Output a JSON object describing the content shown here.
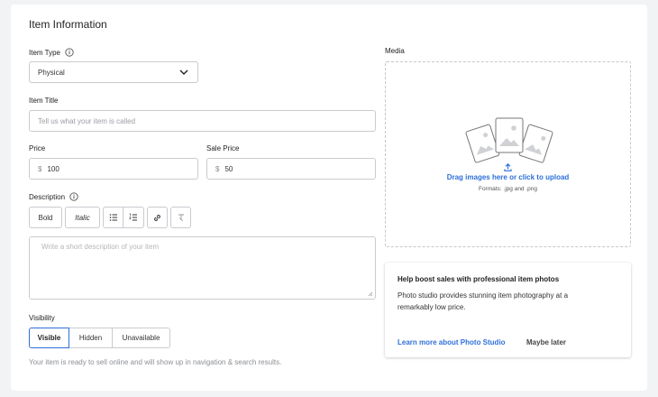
{
  "section_title": "Item Information",
  "item_type": {
    "label": "Item Type",
    "value": "Physical",
    "info_icon": "info-icon"
  },
  "item_title": {
    "label": "Item Title",
    "placeholder": "Tell us what your item is called"
  },
  "price": {
    "label": "Price",
    "prefix": "$",
    "value": "100"
  },
  "sale_price": {
    "label": "Sale Price",
    "prefix": "$",
    "value": "50"
  },
  "description": {
    "label": "Description",
    "placeholder": "Write a short description of your item",
    "toolbar": {
      "bold": "Bold",
      "italic": "Italic",
      "icons": [
        "bulleted-list-icon",
        "numbered-list-icon",
        "link-icon",
        "clear-formatting-icon"
      ]
    }
  },
  "visibility": {
    "label": "Visibility",
    "options": [
      "Visible",
      "Hidden",
      "Unavailable"
    ],
    "selected": "Visible",
    "helper": "Your item is ready to sell online and will show up in navigation & search results."
  },
  "media": {
    "label": "Media",
    "upload_text": "Drag images here or click to upload",
    "formats": "Formats: .jpg and .png"
  },
  "promo": {
    "title": "Help boost sales with professional item photos",
    "body": "Photo studio provides stunning item photography at a remarkably low price.",
    "link": "Learn more about Photo Studio",
    "dismiss": "Maybe later"
  },
  "colors": {
    "accent": "#2e6fd8",
    "border": "#c9cbcf",
    "background": "#f2f3f5"
  }
}
